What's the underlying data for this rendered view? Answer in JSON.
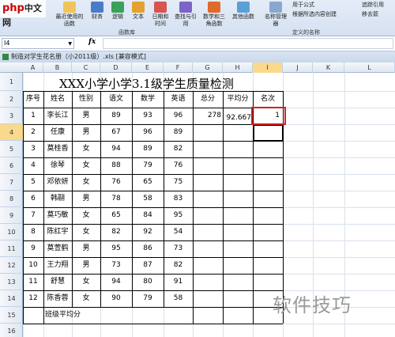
{
  "ribbon": {
    "items": [
      "最近使用的函数",
      "财务",
      "逻辑",
      "文本",
      "日期和时间",
      "查找与引用",
      "数学和三角函数",
      "其他函数",
      "名称管理器",
      "用于公式",
      "根据所选内容创建",
      "追踪引用",
      "移去箭"
    ],
    "groups": [
      "函数库",
      "定义的名称"
    ],
    "colors": {
      "bg": "#dfe8f5",
      "finance": "#4a7bc8",
      "logic": "#3aa15a",
      "text": "#e3a12d",
      "date": "#d9534f",
      "lookup": "#7b63c7",
      "math": "#e06a2a",
      "other": "#5aa0d6"
    }
  },
  "watermark": {
    "logo_a": "php",
    "logo_b": "中文网",
    "bottom": "软件技巧"
  },
  "formula_bar": {
    "name_box": "I4",
    "fx": "fx",
    "value": ""
  },
  "window": {
    "title": "制造对学生花名册（小2011级）.xls [兼容模式]"
  },
  "columns": [
    "A",
    "B",
    "C",
    "D",
    "E",
    "F",
    "G",
    "H",
    "I",
    "J",
    "K",
    "L"
  ],
  "rows": [
    "1",
    "2",
    "3",
    "4",
    "5",
    "6",
    "7",
    "8",
    "9",
    "10",
    "11",
    "12",
    "13",
    "14",
    "15",
    "16"
  ],
  "sheet": {
    "title": "XXX小学小学3.1级学生质量检测",
    "headers": [
      "序号",
      "姓名",
      "性别",
      "语文",
      "数学",
      "英语",
      "总分",
      "平均分",
      "名次"
    ],
    "records": [
      [
        "1",
        "李长江",
        "男",
        "89",
        "93",
        "96",
        "278",
        "92.667",
        "1"
      ],
      [
        "2",
        "任康",
        "男",
        "67",
        "96",
        "89",
        "",
        "",
        ""
      ],
      [
        "3",
        "莫桂香",
        "女",
        "94",
        "89",
        "82",
        "",
        "",
        ""
      ],
      [
        "4",
        "徐琴",
        "女",
        "88",
        "79",
        "76",
        "",
        "",
        ""
      ],
      [
        "5",
        "邓依妍",
        "女",
        "76",
        "65",
        "75",
        "",
        "",
        ""
      ],
      [
        "6",
        "韩翮",
        "男",
        "78",
        "58",
        "83",
        "",
        "",
        ""
      ],
      [
        "7",
        "莫巧敏",
        "女",
        "65",
        "84",
        "95",
        "",
        "",
        ""
      ],
      [
        "8",
        "陈红宇",
        "女",
        "82",
        "92",
        "54",
        "",
        "",
        ""
      ],
      [
        "9",
        "莫萱鹤",
        "男",
        "95",
        "86",
        "73",
        "",
        "",
        ""
      ],
      [
        "10",
        "王力翔",
        "男",
        "73",
        "87",
        "82",
        "",
        "",
        ""
      ],
      [
        "11",
        "舒慧",
        "女",
        "94",
        "80",
        "91",
        "",
        "",
        ""
      ],
      [
        "12",
        "陈香蓉",
        "女",
        "90",
        "79",
        "58",
        "",
        "",
        ""
      ]
    ],
    "footer": "班级平均分"
  }
}
